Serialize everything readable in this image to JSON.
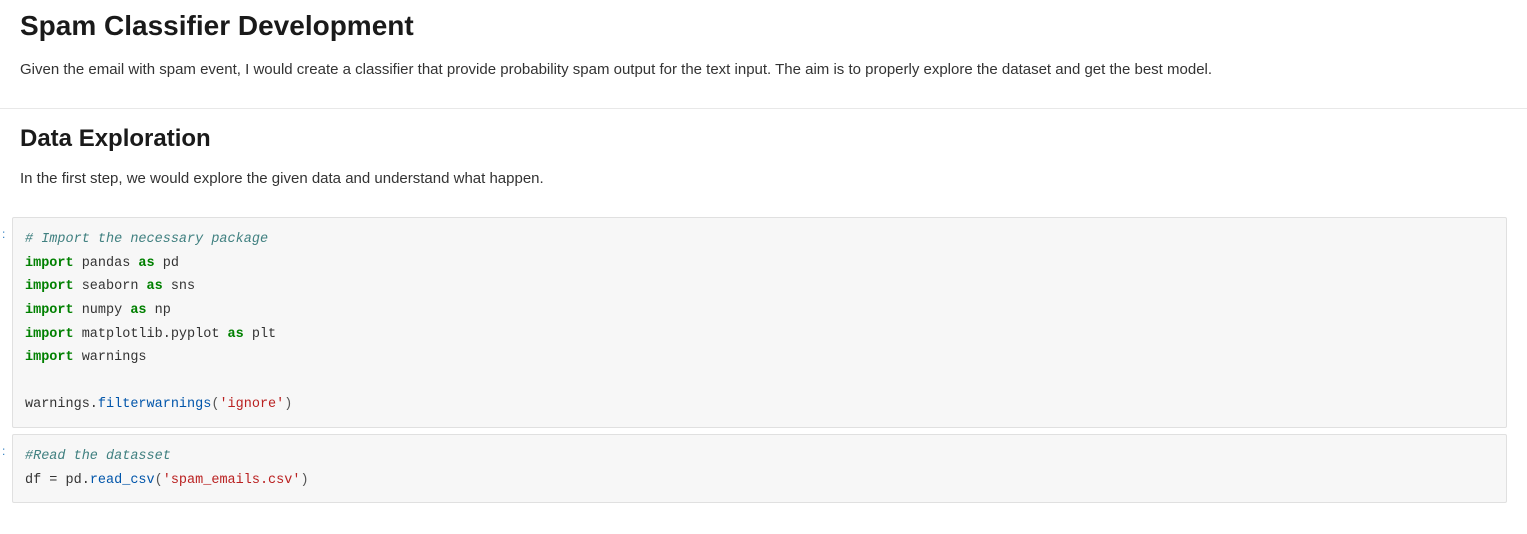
{
  "markdown1": {
    "title": "Spam Classifier Development",
    "paragraph": "Given the email with spam event, I would create a classifier that provide probability spam output for the text input. The aim is to properly explore the dataset and get the best model."
  },
  "markdown2": {
    "title": "Data Exploration",
    "paragraph": "In the first step, we would explore the given data and understand what happen."
  },
  "code1": {
    "prompt": ":",
    "l1_comment": "# Import the necessary package",
    "l2_kw": "import",
    "l2_mod": " pandas ",
    "l2_as": "as",
    "l2_alias": " pd",
    "l3_kw": "import",
    "l3_mod": " seaborn ",
    "l3_as": "as",
    "l3_alias": " sns",
    "l4_kw": "import",
    "l4_mod": " numpy ",
    "l4_as": "as",
    "l4_alias": " np",
    "l5_kw": "import",
    "l5_mod": " matplotlib.pyplot ",
    "l5_as": "as",
    "l5_alias": " plt",
    "l6_kw": "import",
    "l6_mod": " warnings",
    "l8_obj": "warnings.",
    "l8_call": "filterwarnings",
    "l8_open": "(",
    "l8_str": "'ignore'",
    "l8_close": ")"
  },
  "code2": {
    "prompt": ":",
    "l1_comment": "#Read the datasset",
    "l2_lhs": "df = pd.",
    "l2_call": "read_csv",
    "l2_open": "(",
    "l2_str": "'spam_emails.csv'",
    "l2_close": ")"
  }
}
